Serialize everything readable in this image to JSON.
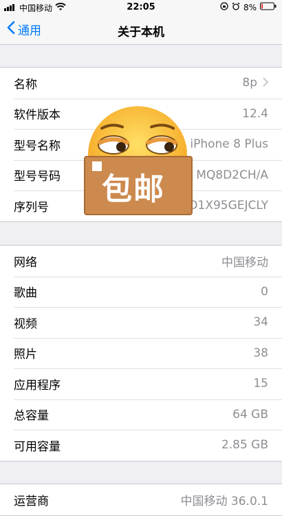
{
  "status": {
    "carrier": "中国移动",
    "time": "22:05",
    "battery": "8%"
  },
  "nav": {
    "back_label": "通用",
    "title": "关于本机"
  },
  "groups": [
    {
      "rows": [
        {
          "label": "名称",
          "value": "8p"
        },
        {
          "label": "软件版本",
          "value": "12.4"
        },
        {
          "label": "型号名称",
          "value": "iPhone 8 Plus"
        },
        {
          "label": "型号号码",
          "value": "MQ8D2CH/A"
        },
        {
          "label": "序列号",
          "value": "FD1X95GEJCLY"
        }
      ]
    },
    {
      "rows": [
        {
          "label": "网络",
          "value": "中国移动"
        },
        {
          "label": "歌曲",
          "value": "0"
        },
        {
          "label": "视频",
          "value": "34"
        },
        {
          "label": "照片",
          "value": "38"
        },
        {
          "label": "应用程序",
          "value": "15"
        },
        {
          "label": "总容量",
          "value": "64 GB"
        },
        {
          "label": "可用容量",
          "value": "2.85 GB"
        }
      ]
    },
    {
      "rows": [
        {
          "label": "运营商",
          "value": "中国移动 36.0.1"
        }
      ]
    }
  ],
  "sticker": {
    "text": "包邮"
  },
  "colors": {
    "accent": "#007aff",
    "background": "#efeff4",
    "value_gray": "#8e8e93"
  }
}
